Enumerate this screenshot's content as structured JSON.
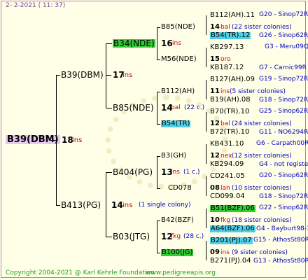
{
  "header": {
    "date": "2-  2-2021 ( 11: 37)"
  },
  "root": {
    "name": "B39(DBM)",
    "ins": "18",
    "ins_label": "ins"
  },
  "gen1": [
    {
      "name": "B39(DBM)",
      "ins": "17",
      "ins_label": "ins"
    },
    {
      "name": "B413(PG)",
      "ins": "14",
      "ins_label": "ins",
      "note": "(1 single colony)"
    }
  ],
  "gen2": [
    {
      "name": "B34(NDE)",
      "ins": "16",
      "ins_label": "ins"
    },
    {
      "name": "B85(NDE)",
      "ins": "14",
      "ins_label": "bal",
      "note": "(22 c.)"
    },
    {
      "name": "B404(PG)",
      "ins": "13",
      "ins_label": "ins",
      "note": "(1 c.)"
    },
    {
      "name": "B03(JTG)",
      "ins": "12",
      "ins_label": "fkg",
      "note": "(28 c.)"
    }
  ],
  "gen3": [
    {
      "name": "B85(NDE)"
    },
    {
      "name": "M56(NDE)"
    },
    {
      "name": "B112(AH)"
    },
    {
      "name": "B54(TR)"
    },
    {
      "name": "B3(GH)"
    },
    {
      "name": "CD078"
    },
    {
      "name": "B42(BZF)"
    },
    {
      "name": "B100(JG)"
    }
  ],
  "gen4": [
    {
      "name": "B112(AH).11",
      "group": "G20 - Sinop72R"
    },
    {
      "name": "B54(TR).12",
      "group": "G26 - Sinop62R"
    },
    {
      "name": "KB297.13",
      "group": "G3 - Meru09Q"
    },
    {
      "name": "KB187.12",
      "group": "G7 - Carnic99R"
    },
    {
      "name": "B127(AH).09",
      "group": "G19 - Sinop72R"
    },
    {
      "name": "B19(AH).08",
      "group": "G18 - Sinop72R"
    },
    {
      "name": "B70(TR).10",
      "group": "G25 - Sinop62R"
    },
    {
      "name": "B72(TR).10",
      "group": "G11 - NO6294R"
    },
    {
      "name": "KB431.10",
      "group": "G6 - Carpath00R"
    },
    {
      "name": "KB294.09",
      "group": "G4 - not registe"
    },
    {
      "name": "CD241.05",
      "group": "G20 - Sinop62R"
    },
    {
      "name": "CD099.04",
      "group": "G18 - Sinop72R"
    },
    {
      "name": "B51(BZF).06",
      "group": "G22 - Sinop62R"
    },
    {
      "name": "A64(BZF).06",
      "group": "G4 - Bayburt98-3"
    },
    {
      "name": "B201(PJ).07",
      "group": "G15 - AthosSt80R"
    },
    {
      "name": "B271(PJ).04",
      "group": "G13 - AthosSt80R"
    }
  ],
  "gen3_ins": [
    {
      "ins": "14",
      "ins_label": "bal",
      "note": "(22 sister colonies)"
    },
    {
      "ins": "15",
      "ins_label": "oro",
      "note": ""
    },
    {
      "ins": "11",
      "ins_label": "ins",
      "note": "(5 sister colonies)"
    },
    {
      "ins": "12",
      "ins_label": "bal",
      "note": "(24 sister colonies)"
    },
    {
      "ins": "12",
      "ins_label": "nex",
      "note": "(12 sister colonies)"
    },
    {
      "ins": "08",
      "ins_label": "lan",
      "note": "(10 sister colonies)"
    },
    {
      "ins": "10",
      "ins_label": "fkg",
      "note": "(18 sister colonies)"
    },
    {
      "ins": "09",
      "ins_label": "ins",
      "note": "(9 sister colonies)"
    }
  ],
  "footer": {
    "copyright": "Copyright 2004-2021 @ Karl Kehrle Foundation",
    "url": "www.pedigreeapis.org"
  }
}
